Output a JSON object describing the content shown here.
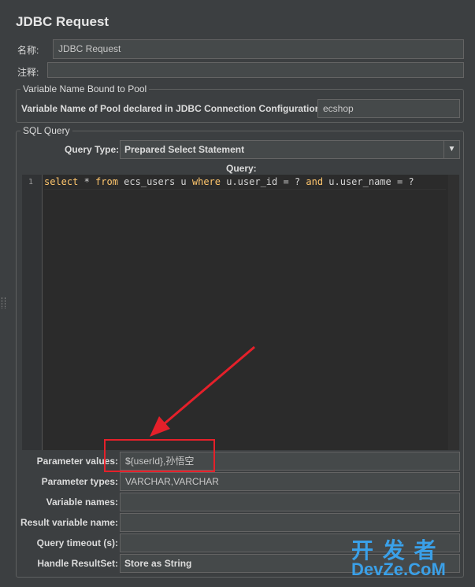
{
  "panel": {
    "title": "JDBC Request"
  },
  "name_row": {
    "label": "名称:",
    "value": "JDBC Request"
  },
  "comment_row": {
    "label": "注释:",
    "value": ""
  },
  "pool_group": {
    "title": "Variable Name Bound to Pool",
    "label": "Variable Name of Pool declared in JDBC Connection Configuration:",
    "value": "ecshop"
  },
  "sql_group": {
    "title": "SQL Query",
    "query_type_label": "Query Type:",
    "query_type_value": "Prepared Select Statement",
    "query_label": "Query:",
    "line_number": "1",
    "code_tokens": [
      {
        "t": "select",
        "kw": true
      },
      {
        "t": " * ",
        "kw": false
      },
      {
        "t": "from",
        "kw": true
      },
      {
        "t": " ecs_users u ",
        "kw": false
      },
      {
        "t": "where",
        "kw": true
      },
      {
        "t": " u.user_id = ? ",
        "kw": false
      },
      {
        "t": "and",
        "kw": true
      },
      {
        "t": " u.user_name = ?",
        "kw": false
      }
    ]
  },
  "params": {
    "values_label": "Parameter values:",
    "values_value": "${userId},孙悟空",
    "types_label": "Parameter types:",
    "types_value": "VARCHAR,VARCHAR",
    "names_label": "Variable names:",
    "names_value": "",
    "result_label": "Result variable name:",
    "result_value": "",
    "timeout_label": "Query timeout (s):",
    "timeout_value": "",
    "resultset_label": "Handle ResultSet:",
    "resultset_value": "Store as String"
  },
  "watermark": {
    "top": "开 发 者",
    "bottom": "DevZe.CoM"
  },
  "colors": {
    "annotation": "#e5202a",
    "keyword": "#ffc66d",
    "background": "#3c3f41"
  }
}
